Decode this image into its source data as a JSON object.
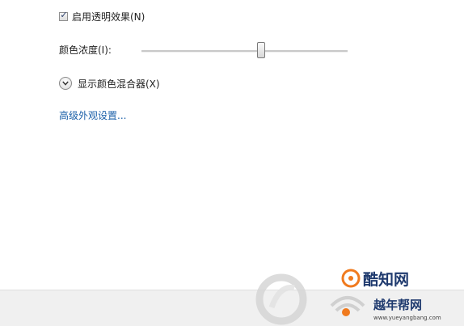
{
  "transparency": {
    "label": "启用透明效果(N)",
    "checked": true,
    "check_glyph": "✓"
  },
  "intensity": {
    "label": "颜色浓度(I):",
    "value_fraction": 0.58
  },
  "mixer": {
    "label": "显示颜色混合器(X)",
    "icon": "chevron-down-icon"
  },
  "advanced": {
    "label": "高级外观设置..."
  },
  "watermark": {
    "brand_top": "酷知网",
    "brand_bottom": "越年帮网",
    "url": "www.yueyangbang.com"
  },
  "colors": {
    "link": "#1a5fa8",
    "footer": "#f0f0f0",
    "watermark_orange": "#f07a1e",
    "watermark_dark": "#1f3a6e"
  }
}
